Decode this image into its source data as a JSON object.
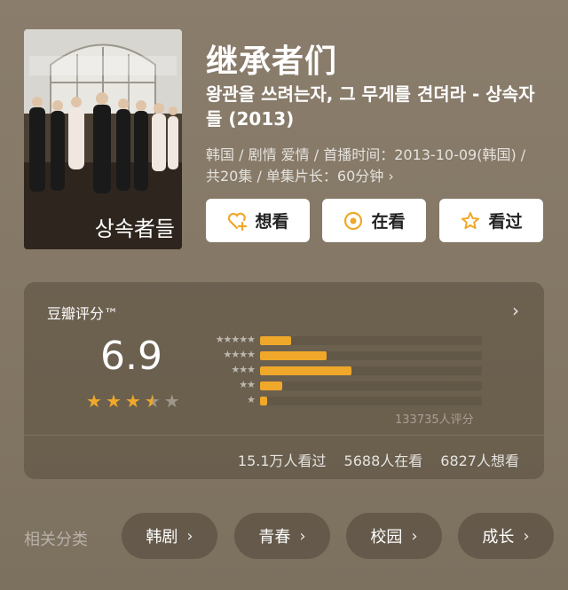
{
  "movie": {
    "title": "继承者们",
    "subtitle": "왕관을 쓰려는자, 그 무게를 견뎌라 - 상속자들 (2013)",
    "meta": "韩国 / 剧情 爱情 / 首播时间：2013-10-09(韩国) / 共20集 / 单集片长：60分钟 ›",
    "poster_text": "상속者들"
  },
  "actions": {
    "want_label": "想看",
    "watching_label": "在看",
    "watched_label": "看过",
    "want_icon": "heart-plus-icon",
    "watching_icon": "target-circle-icon",
    "watched_icon": "star-outline-icon",
    "accent_color": "#f0a82a"
  },
  "rating": {
    "title": "豆瓣评分™",
    "score": "6.9",
    "stars_out_of_5": 3.5,
    "distribution": [
      {
        "stars": "★★★★★",
        "fraction": 0.14
      },
      {
        "stars": "★★★★",
        "fraction": 0.3
      },
      {
        "stars": "★★★",
        "fraction": 0.41
      },
      {
        "stars": "★★",
        "fraction": 0.1
      },
      {
        "stars": "★",
        "fraction": 0.03
      }
    ],
    "total_ratings": "133735人评分",
    "watched_count": "15.1万人看过",
    "watching_count": "5688人在看",
    "want_count": "6827人想看"
  },
  "related": {
    "label": "相关分类",
    "chips": [
      "韩剧",
      "青春",
      "校园",
      "成长"
    ]
  }
}
